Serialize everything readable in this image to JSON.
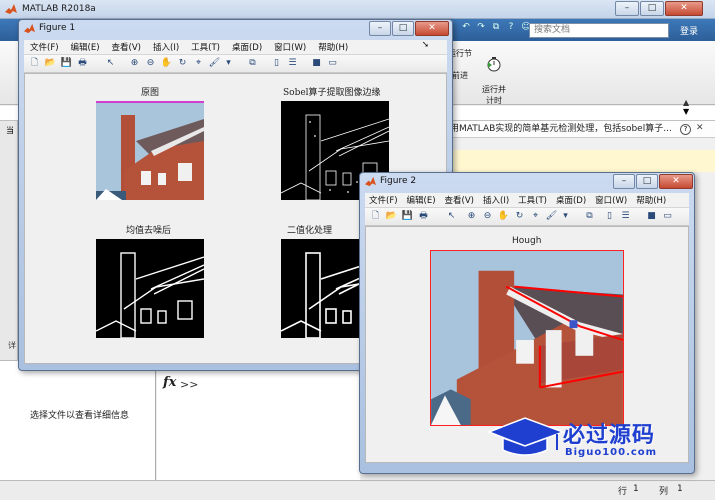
{
  "main_window": {
    "title": "MATLAB R2018a",
    "search_placeholder": "搜索文档",
    "signin": "登录",
    "ribbon": {
      "run_section_label": "运行节",
      "advance_label": "前进",
      "run_time_label": "运行并\n计时"
    },
    "help_bar_text": "用MATLAB实现的简单基元检测处理，包括sobel算子...",
    "detail_panel_text": "选择文件以查看详细信息",
    "detail_head": "详",
    "left_tab": "当",
    "command_prompt": ">>",
    "status": {
      "row_label": "行",
      "row_value": "1",
      "col_label": "列",
      "col_value": "1"
    }
  },
  "figure1": {
    "title": "Figure 1",
    "menu": [
      "文件(F)",
      "编辑(E)",
      "查看(V)",
      "插入(I)",
      "工具(T)",
      "桌面(D)",
      "窗口(W)",
      "帮助(H)"
    ],
    "subplots": {
      "original": "原图",
      "sobel": "Sobel算子提取图像边缘",
      "mean": "均值去噪后",
      "binary": "二值化处理"
    }
  },
  "figure2": {
    "title": "Figure 2",
    "menu": [
      "文件(F)",
      "编辑(E)",
      "查看(V)",
      "插入(I)",
      "工具(T)",
      "桌面(D)",
      "窗口(W)",
      "帮助(H)"
    ],
    "axis_title": "Hough"
  },
  "watermark": {
    "text": "必过源码",
    "sub": "Biguo100.com"
  },
  "colors": {
    "brick": "#b5523a",
    "sky": "#a7c4dc",
    "hough_line": "#ff0000",
    "titlebar_blue": "#c4d4ea"
  }
}
